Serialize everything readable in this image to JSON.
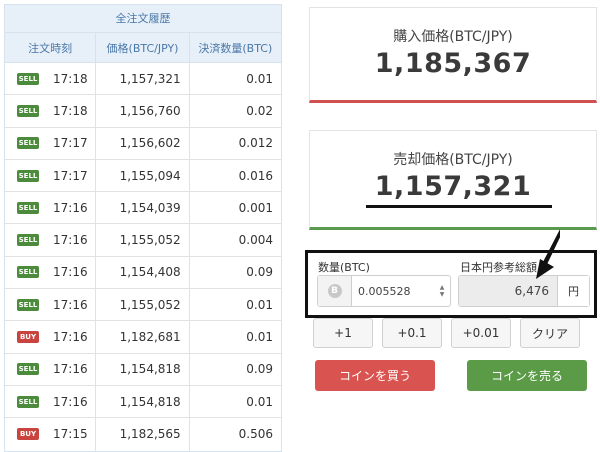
{
  "history": {
    "title": "全注文履歴",
    "columns": [
      "注文時刻",
      "価格(BTC/JPY)",
      "決済数量(BTC)"
    ],
    "rows": [
      {
        "side": "SELL",
        "time": "17:18",
        "price": "1,157,321",
        "qty": "0.01"
      },
      {
        "side": "SELL",
        "time": "17:18",
        "price": "1,156,760",
        "qty": "0.02"
      },
      {
        "side": "SELL",
        "time": "17:17",
        "price": "1,156,602",
        "qty": "0.012"
      },
      {
        "side": "SELL",
        "time": "17:17",
        "price": "1,155,094",
        "qty": "0.016"
      },
      {
        "side": "SELL",
        "time": "17:16",
        "price": "1,154,039",
        "qty": "0.001"
      },
      {
        "side": "SELL",
        "time": "17:16",
        "price": "1,155,052",
        "qty": "0.004"
      },
      {
        "side": "SELL",
        "time": "17:16",
        "price": "1,154,408",
        "qty": "0.09"
      },
      {
        "side": "SELL",
        "time": "17:16",
        "price": "1,155,052",
        "qty": "0.01"
      },
      {
        "side": "BUY",
        "time": "17:16",
        "price": "1,182,681",
        "qty": "0.01"
      },
      {
        "side": "SELL",
        "time": "17:16",
        "price": "1,154,818",
        "qty": "0.09"
      },
      {
        "side": "SELL",
        "time": "17:16",
        "price": "1,154,818",
        "qty": "0.01"
      },
      {
        "side": "BUY",
        "time": "17:15",
        "price": "1,182,565",
        "qty": "0.506"
      }
    ]
  },
  "buy_panel": {
    "label": "購入価格(BTC/JPY)",
    "price": "1,185,367"
  },
  "sell_panel": {
    "label": "売却価格(BTC/JPY)",
    "price": "1,157,321"
  },
  "calculator": {
    "qty_label": "数量(BTC)",
    "qty_value": "0.005528",
    "coin_symbol": "B",
    "jpy_label": "日本円参考総額",
    "jpy_value": "6,476",
    "jpy_unit": "円"
  },
  "steps": [
    "+1",
    "+0.1",
    "+0.01",
    "クリア"
  ],
  "actions": {
    "buy": "コインを買う",
    "sell": "コインを売る"
  },
  "colors": {
    "sell_badge": "#4c8a3c",
    "buy_badge": "#c9443f",
    "buy_accent": "#d05050",
    "sell_accent": "#5a9a4e"
  }
}
